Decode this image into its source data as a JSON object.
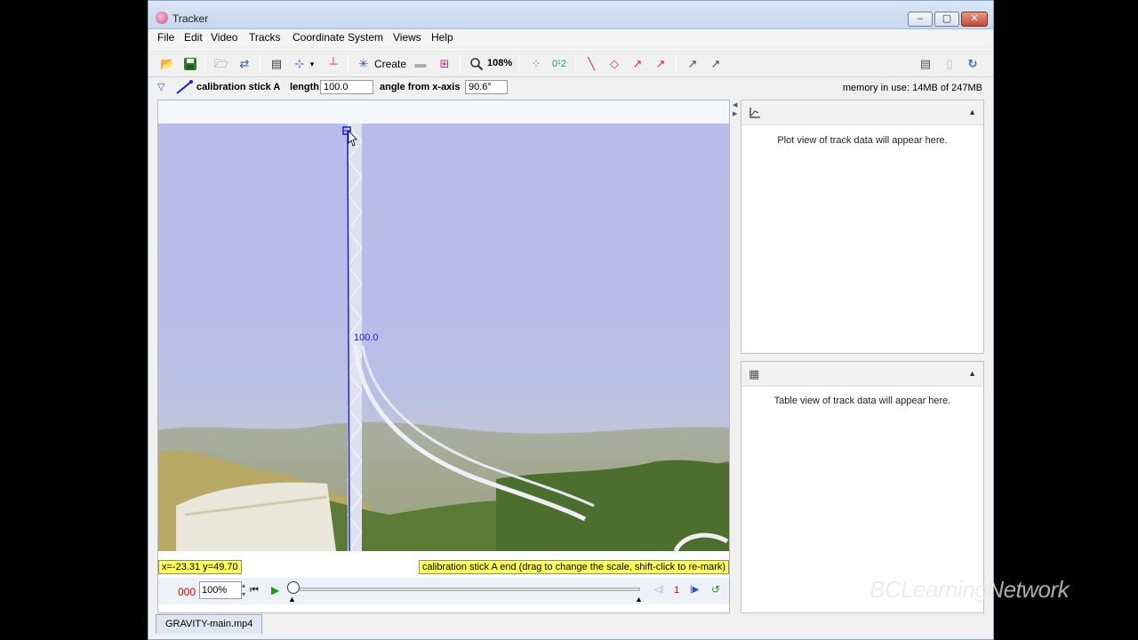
{
  "window": {
    "title": "Tracker"
  },
  "menu": [
    "File",
    "Edit",
    "Video",
    "Tracks",
    "Coordinate System",
    "Views",
    "Help"
  ],
  "toolbar": {
    "create_label": "Create",
    "zoom_label": "108%"
  },
  "trackbar": {
    "track_name": "calibration stick A",
    "length_label": "length",
    "length_value": "100.0",
    "angle_label": "angle from x-axis",
    "angle_value": "90.6°",
    "memory": "memory in use: 14MB of 247MB"
  },
  "video": {
    "stick_label": "100.0",
    "coords": "x=-23.31  y=49.70",
    "hint": "calibration stick A end (drag to change the scale, shift-click to re-mark)"
  },
  "player": {
    "frame": "000",
    "rate": "100%",
    "step": "1"
  },
  "panels": {
    "plot_msg": "Plot view of track data will appear here.",
    "table_msg": "Table view of track data will appear here."
  },
  "tab": {
    "file": "GRAVITY-main.mp4"
  },
  "watermark": "BCLearningNetwork",
  "colors": {
    "stick": "#1a1adb",
    "status_bg": "#ffff55",
    "frame_red": "#d00000"
  }
}
